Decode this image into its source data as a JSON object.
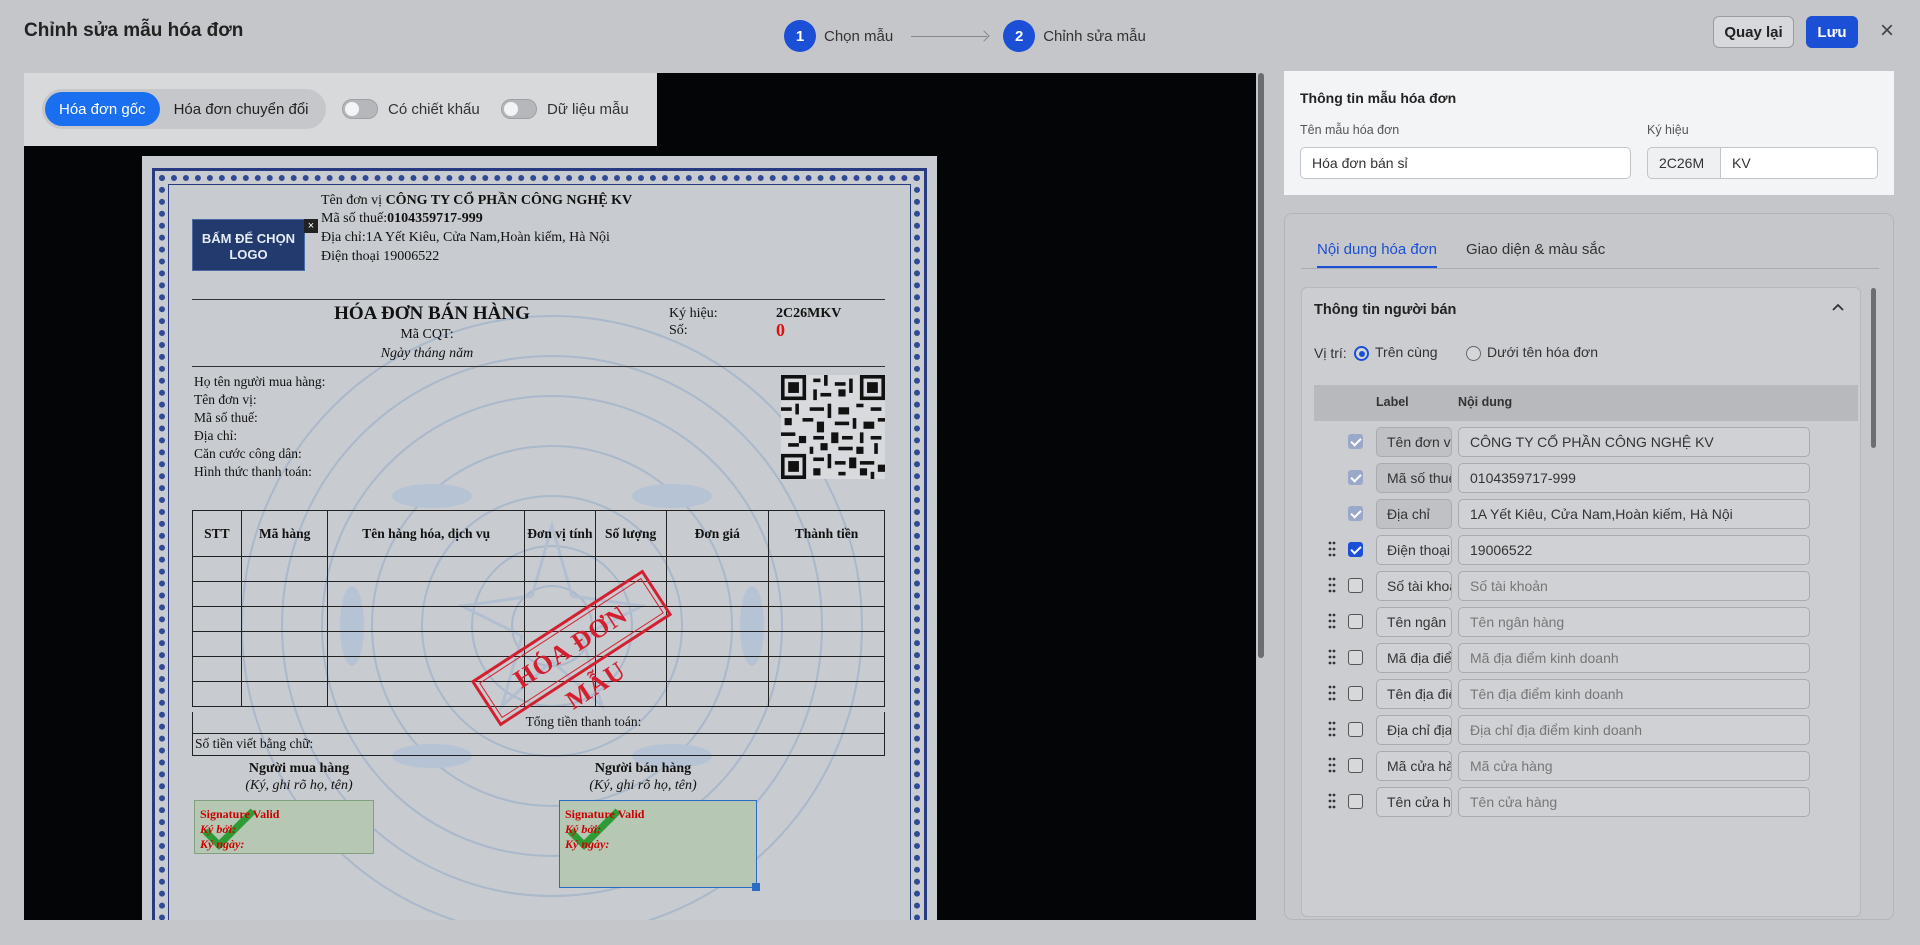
{
  "header": {
    "title": "Chỉnh sửa mẫu hóa đơn",
    "steps": [
      {
        "num": "1",
        "label": "Chọn mẫu"
      },
      {
        "num": "2",
        "label": "Chỉnh sửa mẫu"
      }
    ],
    "back_label": "Quay lại",
    "save_label": "Lưu",
    "close_glyph": "×"
  },
  "preview": {
    "segment": {
      "original": "Hóa đơn gốc",
      "converted": "Hóa đơn chuyển đổi",
      "active": "original"
    },
    "toggles": [
      {
        "label": "Có chiết khấu",
        "on": false
      },
      {
        "label": "Dữ liệu mẫu",
        "on": false
      }
    ]
  },
  "invoice": {
    "logo_text_1": "BẤM ĐỂ CHỌN",
    "logo_text_2": "LOGO",
    "logo_close": "×",
    "seller_name_label": "Tên đơn vị ",
    "seller_name": "CÔNG TY CỔ PHẦN CÔNG NGHỆ KV",
    "tax_label": "Mã số thuế:",
    "tax_code": "0104359717-999",
    "address": "Địa chỉ:1A Yết Kiêu, Cửa Nam,Hoàn kiếm, Hà Nội",
    "phone": "Điện thoại 19006522",
    "title": "HÓA ĐƠN BÁN HÀNG",
    "mcqt": "Mã CQT:",
    "date": "Ngày  tháng  năm",
    "symbol_label": "Ký hiệu:",
    "symbol_value": "2C26MKV",
    "number_label": "Số:",
    "number_value": "0",
    "buyer_lines": [
      "Họ tên người mua hàng:",
      "Tên đơn vị:",
      "Mã số thuế:",
      "Địa chỉ:",
      "Căn cước công dân:",
      "Hình thức thanh toán:"
    ],
    "table_headers": [
      "STT",
      "Mã hàng",
      "Tên hàng hóa, dịch vụ",
      "Đơn vị tính",
      "Số lượng",
      "Đơn giá",
      "Thành tiền"
    ],
    "total_label": "Tổng tiền thanh toán:",
    "words_label": "Số tiền viết bằng chữ:",
    "buyer_sign_title": "Người mua hàng",
    "seller_sign_title": "Người bán hàng",
    "sign_sub": "(Ký, ghi rõ họ, tên)",
    "sig_valid": "Signature Valid",
    "sig_by": "Ký bởi:",
    "sig_date": "Ký ngày:",
    "stamp": "HÓA ĐƠN MẪU"
  },
  "info_panel": {
    "title": "Thông tin mẫu hóa đơn",
    "name_label": "Tên mẫu hóa đơn",
    "name_value": "Hóa đơn bán sỉ",
    "symbol_label": "Ký hiệu",
    "symbol_prefix": "2C26M",
    "symbol_suffix": "KV"
  },
  "content_panel": {
    "tabs": [
      {
        "label": "Nội dung hóa đơn",
        "active": true
      },
      {
        "label": "Giao diện & màu sắc",
        "active": false
      }
    ],
    "section_title": "Thông tin người bán",
    "position_label": "Vị trí:",
    "position_options": [
      {
        "label": "Trên cùng",
        "selected": true
      },
      {
        "label": "Dưới tên hóa đơn",
        "selected": false
      }
    ],
    "col_label": "Label",
    "col_content": "Nội dung",
    "rows": [
      {
        "label": "Tên đơn vị",
        "value": "CÔNG TY CỔ PHẦN CÔNG NGHỆ KV",
        "checked": true,
        "locked": true,
        "placeholder": false
      },
      {
        "label": "Mã số thuế",
        "value": "0104359717-999",
        "checked": true,
        "locked": true,
        "placeholder": false
      },
      {
        "label": "Địa chỉ",
        "value": "1A Yết Kiêu, Cửa Nam,Hoàn kiếm, Hà Nội",
        "checked": true,
        "locked": true,
        "placeholder": false
      },
      {
        "label": "Điện thoại",
        "value": "19006522",
        "checked": true,
        "locked": false,
        "placeholder": false
      },
      {
        "label": "Số tài khoản",
        "value": "Số tài khoản",
        "checked": false,
        "locked": false,
        "placeholder": true
      },
      {
        "label": "Tên ngân hàng",
        "value": "Tên ngân hàng",
        "checked": false,
        "locked": false,
        "placeholder": true
      },
      {
        "label": "Mã địa điểm",
        "value": "Mã địa điểm kinh doanh",
        "checked": false,
        "locked": false,
        "placeholder": true
      },
      {
        "label": "Tên địa điểm",
        "value": "Tên địa điểm kinh doanh",
        "checked": false,
        "locked": false,
        "placeholder": true
      },
      {
        "label": "Địa chỉ địa điểm",
        "value": "Địa chỉ địa điểm kinh doanh",
        "checked": false,
        "locked": false,
        "placeholder": true
      },
      {
        "label": "Mã cửa hàng",
        "value": "Mã cửa hàng",
        "checked": false,
        "locked": false,
        "placeholder": true
      },
      {
        "label": "Tên cửa hàng",
        "value": "Tên cửa hàng",
        "checked": false,
        "locked": false,
        "placeholder": true
      }
    ]
  },
  "colors": {
    "primary": "#1a4fd6",
    "stamp": "#d32030",
    "invoice_border": "#283a80"
  }
}
